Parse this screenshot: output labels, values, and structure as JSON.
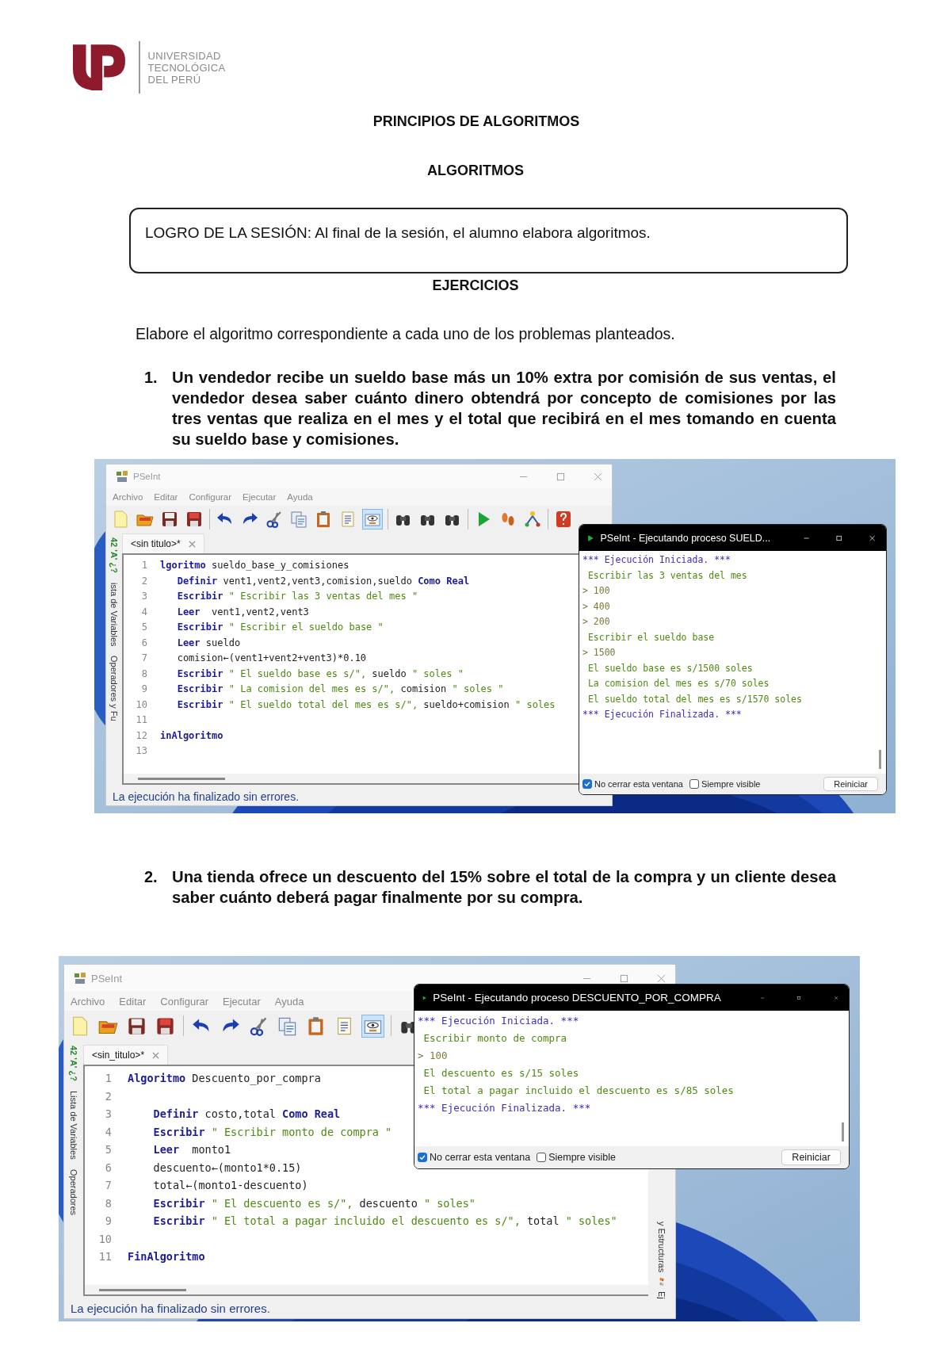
{
  "header": {
    "logo_lines": [
      "UNIVERSIDAD",
      "TECNOLÓGICA",
      "DEL PERÚ"
    ]
  },
  "title": "PRINCIPIOS DE ALGORITMOS",
  "subtitle": "ALGORITMOS",
  "goal": "LOGRO DE LA SESIÓN: Al final de la sesión, el alumno elabora algoritmos.",
  "section": "EJERCICIOS",
  "intro": "Elabore el algoritmo correspondiente a cada uno de los problemas planteados.",
  "exercises": [
    {
      "number": "1.",
      "statement": "Un vendedor recibe un sueldo base más un 10% extra por comisión de sus ventas, el vendedor desea saber cuánto dinero obtendrá por concepto de comisiones por las tres ventas que realiza en el mes y el total que recibirá en el mes tomando en cuenta su sueldo base y comisiones.",
      "screenshot": {
        "editor": {
          "title": "PSeInt",
          "menu": [
            "Archivo",
            "Editar",
            "Configurar",
            "Ejecutar",
            "Ayuda"
          ],
          "tab": "<sin titulo>*",
          "side_symbols": "42 'A' ¿?",
          "side_labels": [
            "ista de Variables",
            "Operadores y Fu"
          ],
          "lines": [
            {
              "number": "1",
              "tokens": [
                {
                  "kind": "keyword",
                  "text": "lgoritmo"
                },
                {
                  "kind": "plain",
                  "text": " sueldo_base_y_comisiones"
                }
              ]
            },
            {
              "number": "2",
              "tokens": [
                {
                  "kind": "keyword",
                  "text": "   Definir"
                },
                {
                  "kind": "plain",
                  "text": " vent1,vent2,vent3,comision,sueldo "
                },
                {
                  "kind": "keyword",
                  "text": "Como Real"
                }
              ]
            },
            {
              "number": "3",
              "tokens": [
                {
                  "kind": "keyword",
                  "text": "   Escribir"
                },
                {
                  "kind": "string",
                  "text": " \" Escribir las 3 ventas del mes \""
                }
              ]
            },
            {
              "number": "4",
              "tokens": [
                {
                  "kind": "keyword",
                  "text": "   Leer"
                },
                {
                  "kind": "plain",
                  "text": "  vent1,vent2,vent3"
                }
              ]
            },
            {
              "number": "5",
              "tokens": [
                {
                  "kind": "keyword",
                  "text": "   Escribir"
                },
                {
                  "kind": "string",
                  "text": " \" Escribir el sueldo base \""
                }
              ]
            },
            {
              "number": "6",
              "tokens": [
                {
                  "kind": "keyword",
                  "text": "   Leer"
                },
                {
                  "kind": "plain",
                  "text": " sueldo"
                }
              ]
            },
            {
              "number": "7",
              "tokens": [
                {
                  "kind": "plain",
                  "text": "   comision←(vent1+vent2+vent3)*0.10"
                }
              ]
            },
            {
              "number": "8",
              "tokens": [
                {
                  "kind": "keyword",
                  "text": "   Escribir"
                },
                {
                  "kind": "string",
                  "text": " \" El sueldo base es s/\","
                },
                {
                  "kind": "plain",
                  "text": " sueldo "
                },
                {
                  "kind": "string",
                  "text": "\" soles \""
                }
              ]
            },
            {
              "number": "9",
              "tokens": [
                {
                  "kind": "keyword",
                  "text": "   Escribir"
                },
                {
                  "kind": "string",
                  "text": " \" La comision del mes es s/\","
                },
                {
                  "kind": "plain",
                  "text": " comision "
                },
                {
                  "kind": "string",
                  "text": "\" soles \""
                }
              ]
            },
            {
              "number": "10",
              "tokens": [
                {
                  "kind": "keyword",
                  "text": "   Escribir"
                },
                {
                  "kind": "string",
                  "text": " \" El sueldo total del mes es s/\","
                },
                {
                  "kind": "plain",
                  "text": " sueldo+comision "
                },
                {
                  "kind": "string",
                  "text": "\" soles"
                }
              ]
            },
            {
              "number": "11"
            },
            {
              "number": "12",
              "tokens": [
                {
                  "kind": "keyword",
                  "text": "inAlgoritmo"
                }
              ]
            },
            {
              "number": "13"
            }
          ],
          "status": "La ejecución ha finalizado sin errores."
        },
        "console": {
          "title": "PSeInt - Ejecutando proceso SUELD...",
          "lines": [
            {
              "kind": "info",
              "text": "*** Ejecución Iniciada. ***"
            },
            {
              "kind": "output",
              "text": " Escribir las 3 ventas del mes"
            },
            {
              "kind": "input",
              "text": "> 100"
            },
            {
              "kind": "input",
              "text": "> 400"
            },
            {
              "kind": "input",
              "text": "> 200"
            },
            {
              "kind": "output",
              "text": " Escribir el sueldo base"
            },
            {
              "kind": "input",
              "text": "> 1500"
            },
            {
              "kind": "output",
              "text": " El sueldo base es s/1500 soles"
            },
            {
              "kind": "output",
              "text": " La comision del mes es s/70 soles"
            },
            {
              "kind": "output",
              "text": " El sueldo total del mes es s/1570 soles"
            },
            {
              "kind": "info",
              "text": "*** Ejecución Finalizada. ***"
            }
          ],
          "options": [
            {
              "label": "No cerrar esta ventana",
              "checked": true
            },
            {
              "label": "Siempre visible",
              "checked": false
            }
          ],
          "button": "Reiniciar"
        }
      }
    },
    {
      "number": "2.",
      "statement": "Una tienda ofrece un descuento del 15% sobre el total de la compra y un cliente desea saber cuánto deberá pagar finalmente por su compra.",
      "screenshot": {
        "editor": {
          "title": "PSeInt",
          "menu": [
            "Archivo",
            "Editar",
            "Configurar",
            "Ejecutar",
            "Ayuda"
          ],
          "tab": "<sin_titulo>*",
          "side_symbols": "42 'A' ¿?",
          "side_labels": [
            "Lista de Variables",
            "Operadores"
          ],
          "right_labels": [
            "y Estructuras",
            "Ej"
          ],
          "lines": [
            {
              "number": "1",
              "tokens": [
                {
                  "kind": "keyword",
                  "text": "Algoritmo"
                },
                {
                  "kind": "plain",
                  "text": " Descuento_por_compra"
                }
              ]
            },
            {
              "number": "2"
            },
            {
              "number": "3",
              "tokens": [
                {
                  "kind": "keyword",
                  "text": "    Definir"
                },
                {
                  "kind": "plain",
                  "text": " costo,total "
                },
                {
                  "kind": "keyword",
                  "text": "Como Real"
                }
              ]
            },
            {
              "number": "4",
              "tokens": [
                {
                  "kind": "keyword",
                  "text": "    Escribir"
                },
                {
                  "kind": "string",
                  "text": " \" Escribir monto de compra \""
                }
              ]
            },
            {
              "number": "5",
              "tokens": [
                {
                  "kind": "keyword",
                  "text": "    Leer"
                },
                {
                  "kind": "plain",
                  "text": "  monto1"
                }
              ]
            },
            {
              "number": "6",
              "tokens": [
                {
                  "kind": "plain",
                  "text": "    descuento←(monto1*0.15)"
                }
              ]
            },
            {
              "number": "7",
              "tokens": [
                {
                  "kind": "plain",
                  "text": "    total←(monto1-descuento)"
                }
              ]
            },
            {
              "number": "8",
              "tokens": [
                {
                  "kind": "keyword",
                  "text": "    Escribir"
                },
                {
                  "kind": "string",
                  "text": " \" El descuento es s/\","
                },
                {
                  "kind": "plain",
                  "text": " descuento "
                },
                {
                  "kind": "string",
                  "text": "\" soles\""
                }
              ]
            },
            {
              "number": "9",
              "tokens": [
                {
                  "kind": "keyword",
                  "text": "    Escribir"
                },
                {
                  "kind": "string",
                  "text": " \" El total a pagar incluido el descuento es s/\","
                },
                {
                  "kind": "plain",
                  "text": " total "
                },
                {
                  "kind": "string",
                  "text": "\" soles\""
                }
              ]
            },
            {
              "number": "10"
            },
            {
              "number": "11",
              "tokens": [
                {
                  "kind": "keyword",
                  "text": "FinAlgoritmo"
                }
              ]
            }
          ],
          "status": "La ejecución ha finalizado sin errores."
        },
        "console": {
          "title": "PSeInt - Ejecutando proceso DESCUENTO_POR_COMPRA",
          "lines": [
            {
              "kind": "info",
              "text": "*** Ejecución Iniciada. ***"
            },
            {
              "kind": "output",
              "text": " Escribir monto de compra"
            },
            {
              "kind": "input",
              "text": "> 100"
            },
            {
              "kind": "output",
              "text": " El descuento es s/15 soles"
            },
            {
              "kind": "output",
              "text": " El total a pagar incluido el descuento es s/85 soles"
            },
            {
              "kind": "info",
              "text": "*** Ejecución Finalizada. ***"
            }
          ],
          "options": [
            {
              "label": "No cerrar esta ventana",
              "checked": true
            },
            {
              "label": "Siempre visible",
              "checked": false
            }
          ],
          "button": "Reiniciar"
        }
      }
    }
  ]
}
